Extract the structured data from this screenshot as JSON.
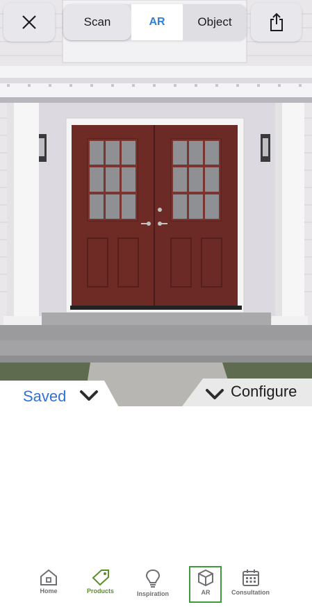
{
  "top_bar": {
    "close_icon": "close-icon",
    "share_icon": "share-icon",
    "segments": [
      {
        "label": "Scan",
        "selected": false
      },
      {
        "label": "AR",
        "selected": true
      },
      {
        "label": "Object",
        "selected": false
      }
    ]
  },
  "bottom_panel": {
    "saved_label": "Saved",
    "saved_icon": "chevron-down-icon",
    "configure_label": "Configure",
    "configure_icon": "chevron-down-icon"
  },
  "nav": {
    "items": [
      {
        "label": "Home",
        "icon": "home-icon"
      },
      {
        "label": "Products",
        "icon": "tag-icon",
        "color": "#5a8f2a"
      },
      {
        "label": "Inspiration",
        "icon": "lightbulb-icon"
      },
      {
        "label": "AR",
        "icon": "cube-icon",
        "selected": true,
        "highlight": "#3f9a3f"
      },
      {
        "label": "Consultation",
        "icon": "calendar-icon"
      }
    ]
  },
  "colors": {
    "door": "#6e2b26",
    "accent_blue": "#2f72d6"
  }
}
